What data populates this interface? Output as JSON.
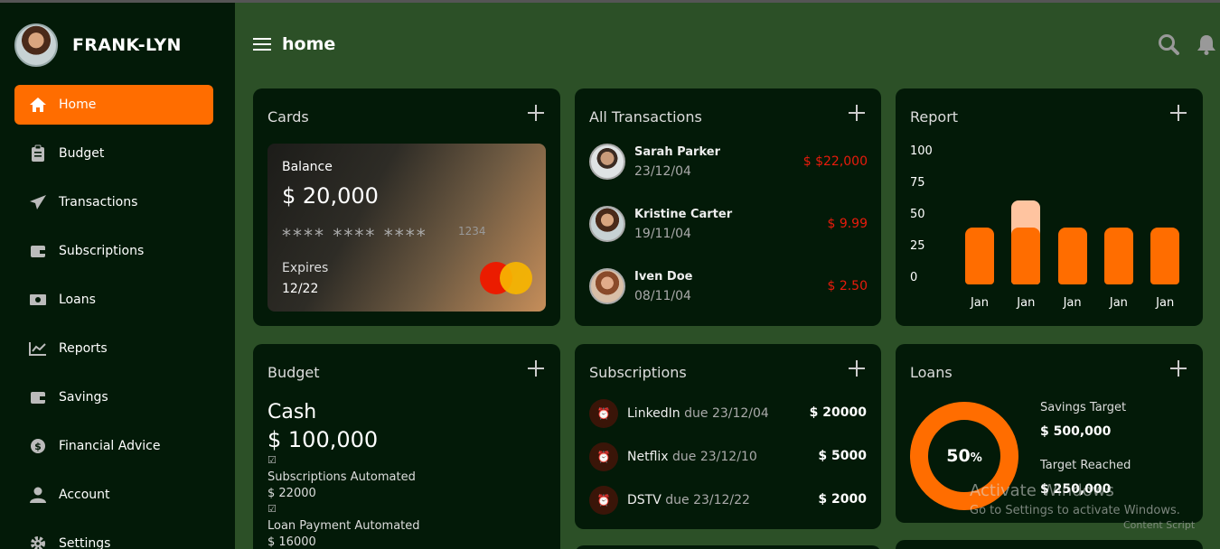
{
  "user": {
    "name": "FRANK-LYN"
  },
  "header": {
    "title": "home"
  },
  "sidebar": {
    "items": [
      {
        "label": "Home",
        "icon": "home-icon",
        "active": true
      },
      {
        "label": "Budget",
        "icon": "clipboard-icon"
      },
      {
        "label": "Transactions",
        "icon": "paper-plane-icon"
      },
      {
        "label": "Subscriptions",
        "icon": "wallet-icon"
      },
      {
        "label": "Loans",
        "icon": "money-bill-icon"
      },
      {
        "label": "Reports",
        "icon": "line-chart-icon"
      },
      {
        "label": "Savings",
        "icon": "wallet-icon"
      },
      {
        "label": "Financial Advice",
        "icon": "dollar-circle-icon"
      },
      {
        "label": "Account",
        "icon": "user-icon"
      },
      {
        "label": "Settings",
        "icon": "gear-icon"
      }
    ]
  },
  "cards": {
    "title": "Cards",
    "balance_label": "Balance",
    "balance": "$ 20,000",
    "masked": "**** **** ****",
    "last4": "1234",
    "expires_label": "Expires",
    "expires": "12/22",
    "brand_colors": [
      "#eb1c00",
      "#f7b500"
    ]
  },
  "transactions": {
    "title": "All Transactions",
    "items": [
      {
        "name": "Sarah Parker",
        "date": "23/12/04",
        "amount": "$ $22,000"
      },
      {
        "name": "Kristine Carter",
        "date": "19/11/04",
        "amount": "$ 9.99"
      },
      {
        "name": "Iven Doe",
        "date": "08/11/04",
        "amount": "$ 2.50"
      }
    ]
  },
  "report": {
    "title": "Report"
  },
  "chart_data": {
    "type": "bar",
    "categories": [
      "Jan",
      "Jan",
      "Jan",
      "Jan",
      "Jan"
    ],
    "yticks": [
      "100",
      "75",
      "50",
      "25",
      "0"
    ],
    "ylim": [
      0,
      100
    ],
    "series": [
      {
        "values": [
          45,
          45,
          45,
          45,
          45
        ],
        "color": "#ff6d00"
      },
      {
        "values": [
          0,
          70,
          0,
          0,
          0
        ],
        "color": "#ffc4a0"
      }
    ]
  },
  "budget": {
    "title": "Budget",
    "cash_label": "Cash",
    "cash": "$ 100,000",
    "items": [
      {
        "label": "Subscriptions Automated",
        "value": "$ 22000"
      },
      {
        "label": "Loan Payment Automated",
        "value": "$ 16000"
      }
    ]
  },
  "subscriptions": {
    "title": "Subscriptions",
    "items": [
      {
        "name": "LinkedIn",
        "due": "due 23/12/04",
        "amount": "$ 20000"
      },
      {
        "name": "Netflix",
        "due": "due 23/12/10",
        "amount": "$ 5000"
      },
      {
        "name": "DSTV",
        "due": "due 23/12/22",
        "amount": "$ 2000"
      }
    ]
  },
  "loans": {
    "title": "Loans",
    "percent": "50",
    "percent_suffix": "%",
    "savings_target_label": "Savings Target",
    "savings_target": "$ 500,000",
    "target_reached_label": "Target Reached",
    "target_reached": "$ 250,000"
  },
  "watermark": {
    "line1": "Activate Windows",
    "line2": "Go to Settings to activate Windows.",
    "line3": "Content Script"
  },
  "colors": {
    "accent": "#ff6d00",
    "bg": "#2c5027",
    "panel": "#031a08",
    "negative": "#e91b0c"
  }
}
